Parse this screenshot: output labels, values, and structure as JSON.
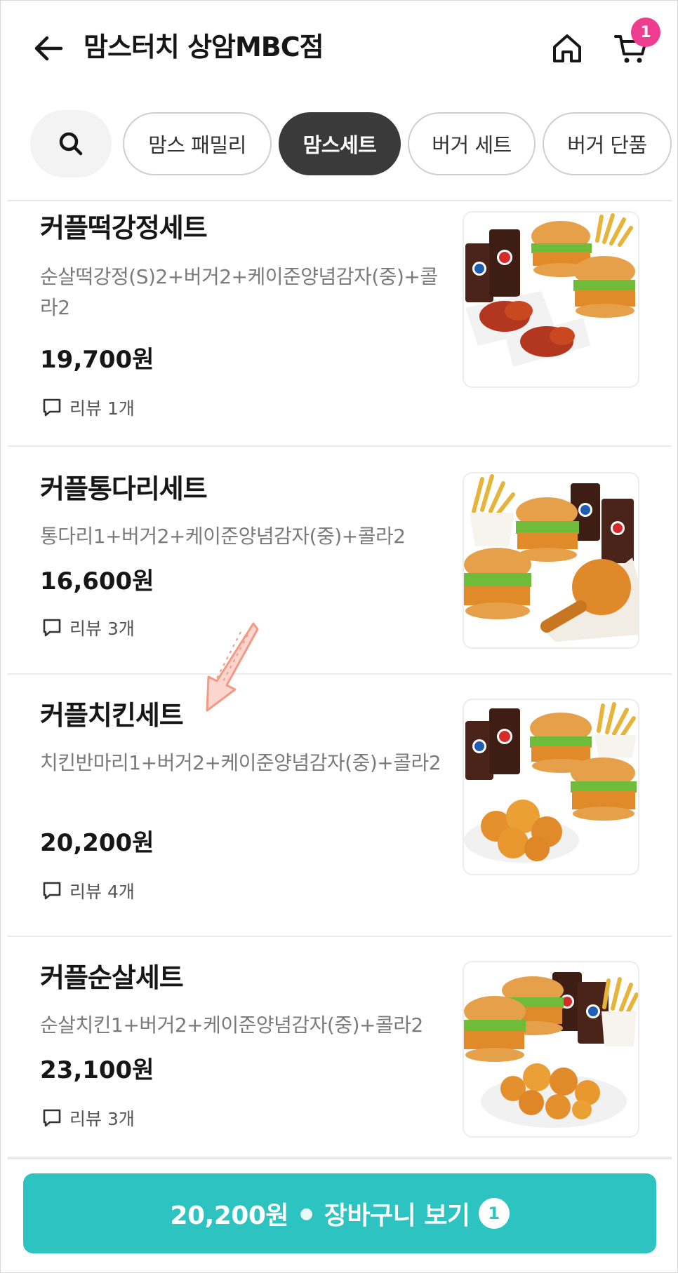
{
  "header": {
    "title": "맘스터치 상암MBC점",
    "cart_count": "1"
  },
  "categories": [
    {
      "label": "맘스 패밀리",
      "active": false
    },
    {
      "label": "맘스세트",
      "active": true
    },
    {
      "label": "버거 세트",
      "active": false
    },
    {
      "label": "버거 단품",
      "active": false
    }
  ],
  "menu": [
    {
      "name": "커플떡강정세트",
      "desc": "순살떡강정(S)2+버거2+케이준양념감자(중)+콜라2",
      "price": "19,700원",
      "review": "리뷰 1개"
    },
    {
      "name": "커플통다리세트",
      "desc": "통다리1+버거2+케이준양념감자(중)+콜라2",
      "price": "16,600원",
      "review": "리뷰 3개"
    },
    {
      "name": "커플치킨세트",
      "desc": "치킨반마리1+버거2+케이준양념감자(중)+콜라2",
      "price": "20,200원",
      "review": "리뷰 4개"
    },
    {
      "name": "커플순살세트",
      "desc": "순살치킨1+버거2+케이준양념감자(중)+콜라2",
      "price": "23,100원",
      "review": "리뷰 3개"
    }
  ],
  "cart_button": {
    "price": "20,200원",
    "label": "장바구니 보기",
    "count": "1"
  },
  "colors": {
    "accent": "#2dc3c0",
    "badge": "#ee3c8e",
    "active_chip": "#3a3a3a",
    "annotation_arrow": "#f6a89a"
  }
}
